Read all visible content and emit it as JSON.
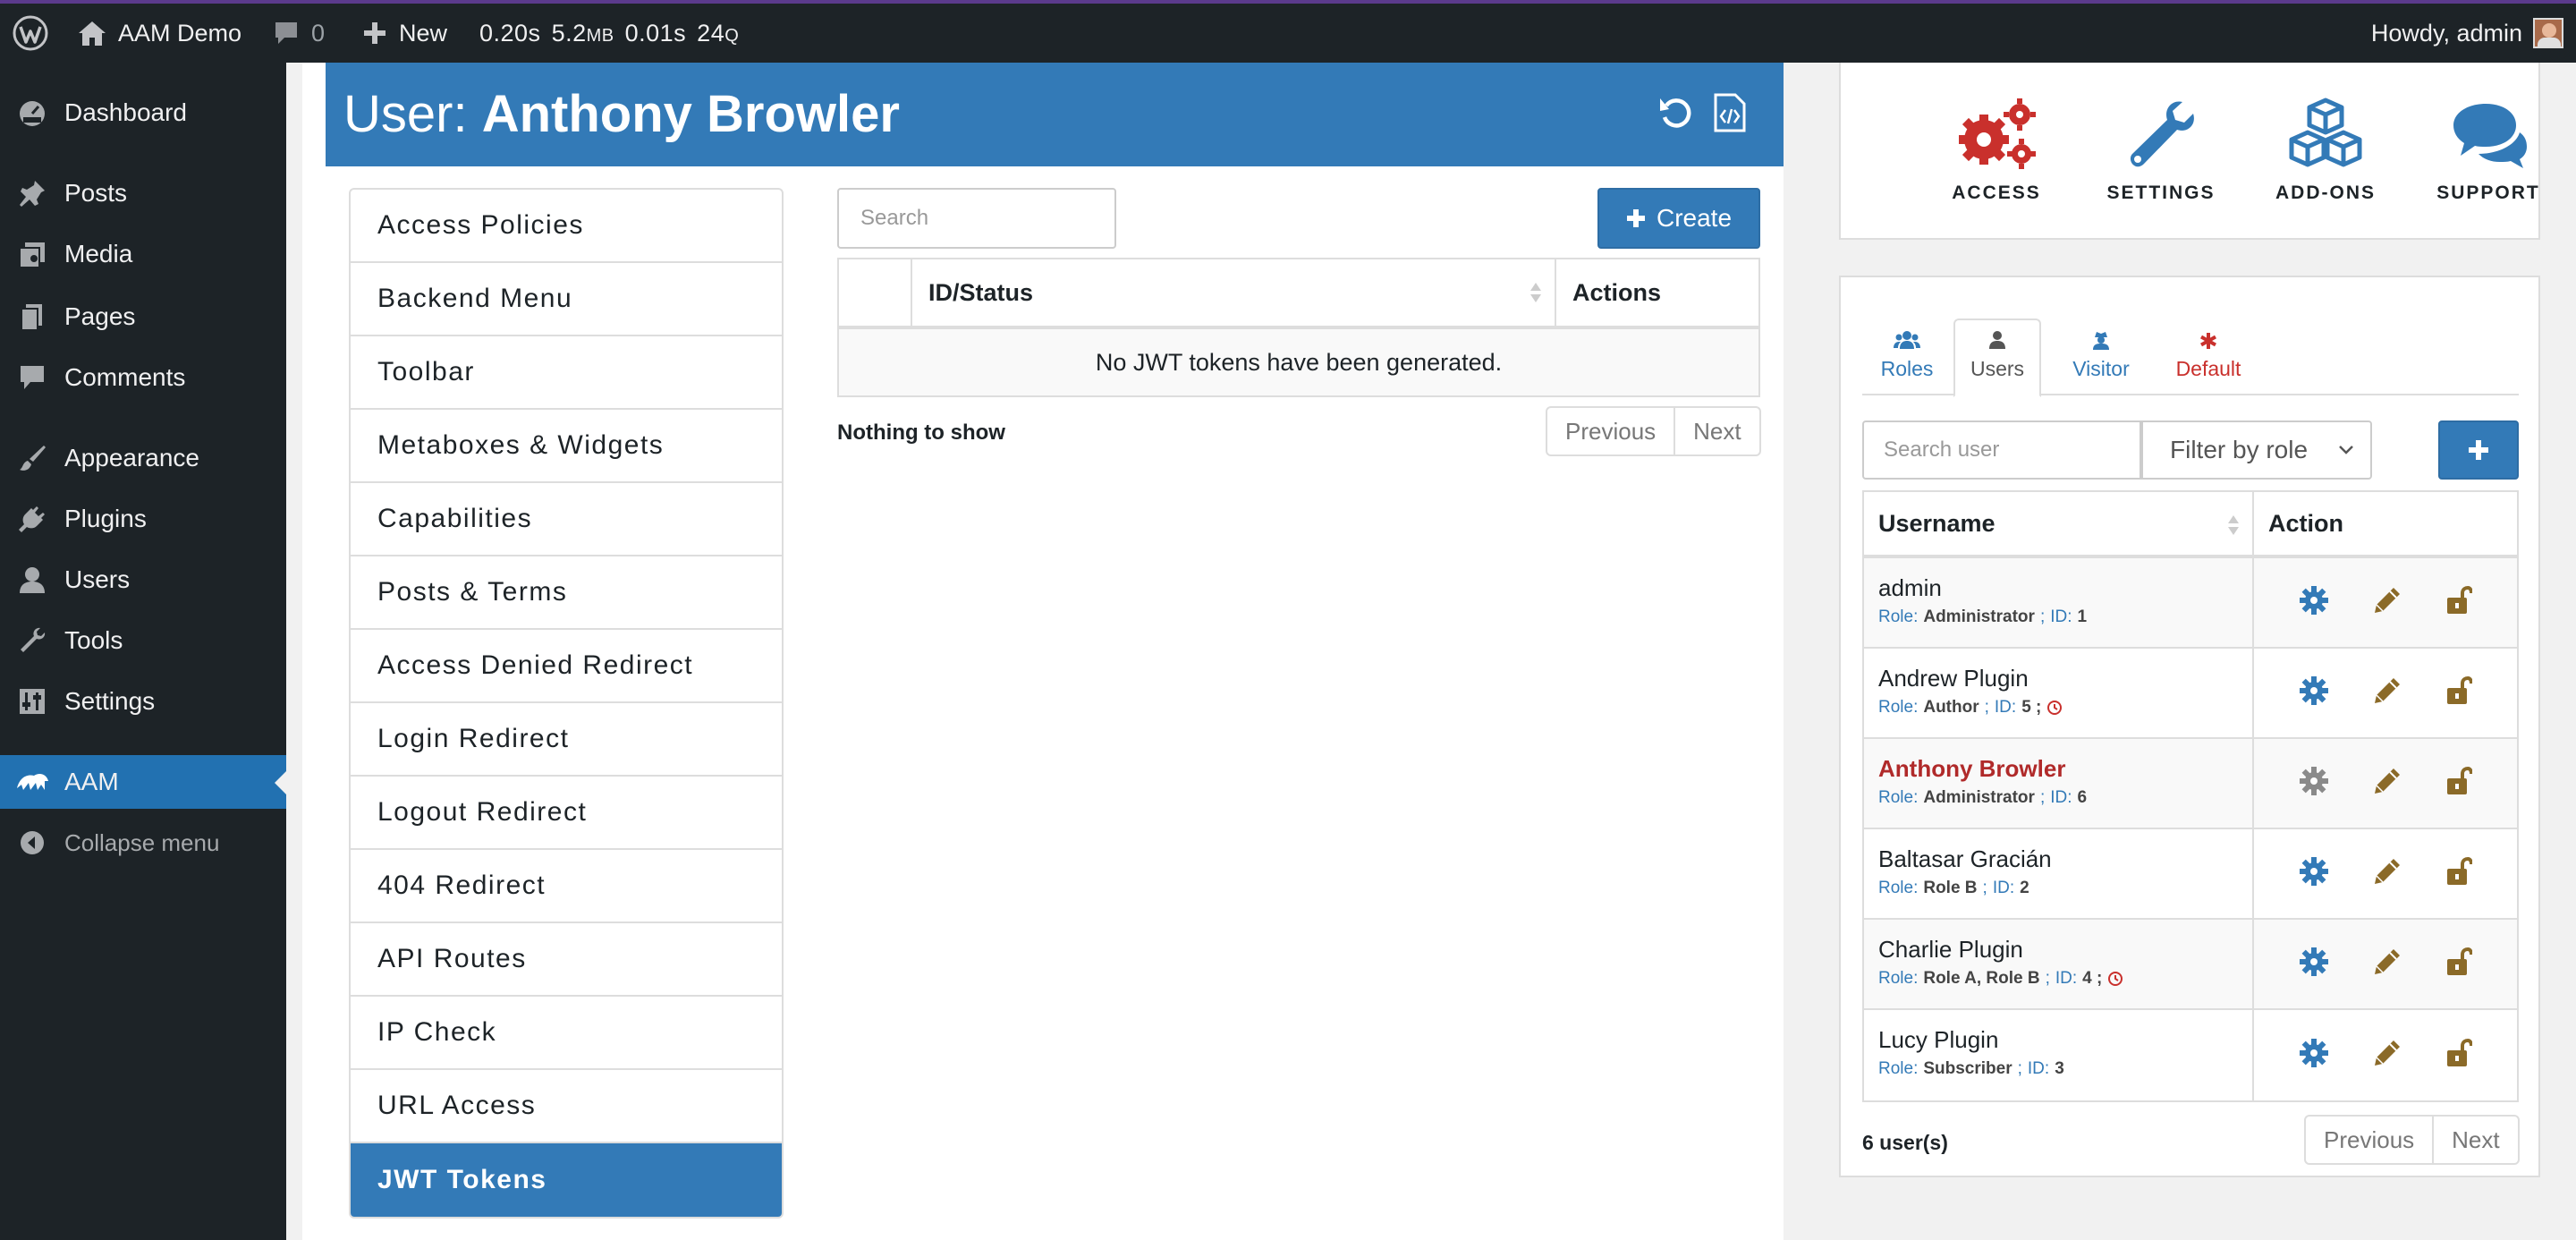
{
  "colors": {
    "admin_bar": "#1d2327",
    "brand_blue": "#337ab7",
    "wp_blue": "#2271b1",
    "danger_red": "#c9302c",
    "tile_red": "#c9302c",
    "edit_brown": "#8b6a28"
  },
  "topbar": {
    "wp_logo_icon": "wordpress-icon",
    "site_name": "AAM Demo",
    "comments_count": "0",
    "new_label": "New",
    "stats_time": "0.20s",
    "stats_mem": "5.2",
    "stats_mem_unit": "MB",
    "stats_db_time": "0.01s",
    "stats_queries": "24",
    "stats_queries_unit": "Q",
    "howdy": "Howdy, admin"
  },
  "sidebar": {
    "items": [
      {
        "label": "Dashboard",
        "icon": "dashboard-icon"
      },
      {
        "label": "Posts",
        "icon": "pin-icon"
      },
      {
        "label": "Media",
        "icon": "media-icon"
      },
      {
        "label": "Pages",
        "icon": "pages-icon"
      },
      {
        "label": "Comments",
        "icon": "comment-icon"
      },
      {
        "label": "Appearance",
        "icon": "brush-icon"
      },
      {
        "label": "Plugins",
        "icon": "plug-icon"
      },
      {
        "label": "Users",
        "icon": "user-icon"
      },
      {
        "label": "Tools",
        "icon": "wrench-icon"
      },
      {
        "label": "Settings",
        "icon": "sliders-icon"
      },
      {
        "label": "AAM",
        "icon": "aam-icon"
      }
    ],
    "collapse_label": "Collapse menu"
  },
  "header": {
    "prefix": "User:",
    "name": "Anthony Browler"
  },
  "features": [
    "Access Policies",
    "Backend Menu",
    "Toolbar",
    "Metaboxes & Widgets",
    "Capabilities",
    "Posts & Terms",
    "Access Denied Redirect",
    "Login Redirect",
    "Logout Redirect",
    "404 Redirect",
    "API Routes",
    "IP Check",
    "URL Access",
    "JWT Tokens"
  ],
  "jwt": {
    "search_placeholder": "Search",
    "create_label": "Create",
    "col_status": "ID/Status",
    "col_actions": "Actions",
    "empty_message": "No JWT tokens have been generated.",
    "nothing_to_show": "Nothing to show",
    "prev": "Previous",
    "next": "Next"
  },
  "tiles": [
    {
      "label": "ACCESS",
      "icon": "gears-icon"
    },
    {
      "label": "SETTINGS",
      "icon": "wrench-icon"
    },
    {
      "label": "ADD-ONS",
      "icon": "cubes-icon"
    },
    {
      "label": "SUPPORT",
      "icon": "chat-icon"
    }
  ],
  "subject_tabs": [
    "Roles",
    "Users",
    "Visitor",
    "Default"
  ],
  "user_search_placeholder": "Search user",
  "role_filter": "Filter by role",
  "user_table": {
    "col_username": "Username",
    "col_action": "Action"
  },
  "users": [
    {
      "name": "admin",
      "role_label": "Role:",
      "role": "Administrator",
      "id_label": "ID:",
      "id": "1",
      "flag": false,
      "current": false
    },
    {
      "name": "Andrew Plugin",
      "role_label": "Role:",
      "role": "Author",
      "id_label": "ID:",
      "id": "5 ;",
      "flag": true,
      "current": false
    },
    {
      "name": "Anthony Browler",
      "role_label": "Role:",
      "role": "Administrator",
      "id_label": "ID:",
      "id": "6",
      "flag": false,
      "current": true
    },
    {
      "name": "Baltasar Gracián",
      "role_label": "Role:",
      "role": "Role B",
      "id_label": "ID:",
      "id": "2",
      "flag": false,
      "current": false
    },
    {
      "name": "Charlie Plugin",
      "role_label": "Role:",
      "role": "Role A, Role B",
      "id_label": "ID:",
      "id": "4 ;",
      "flag": true,
      "current": false
    },
    {
      "name": "Lucy Plugin",
      "role_label": "Role:",
      "role": "Subscriber",
      "id_label": "ID:",
      "id": "3",
      "flag": false,
      "current": false
    }
  ],
  "user_count": "6 user(s)",
  "user_pager": {
    "prev": "Previous",
    "next": "Next"
  }
}
